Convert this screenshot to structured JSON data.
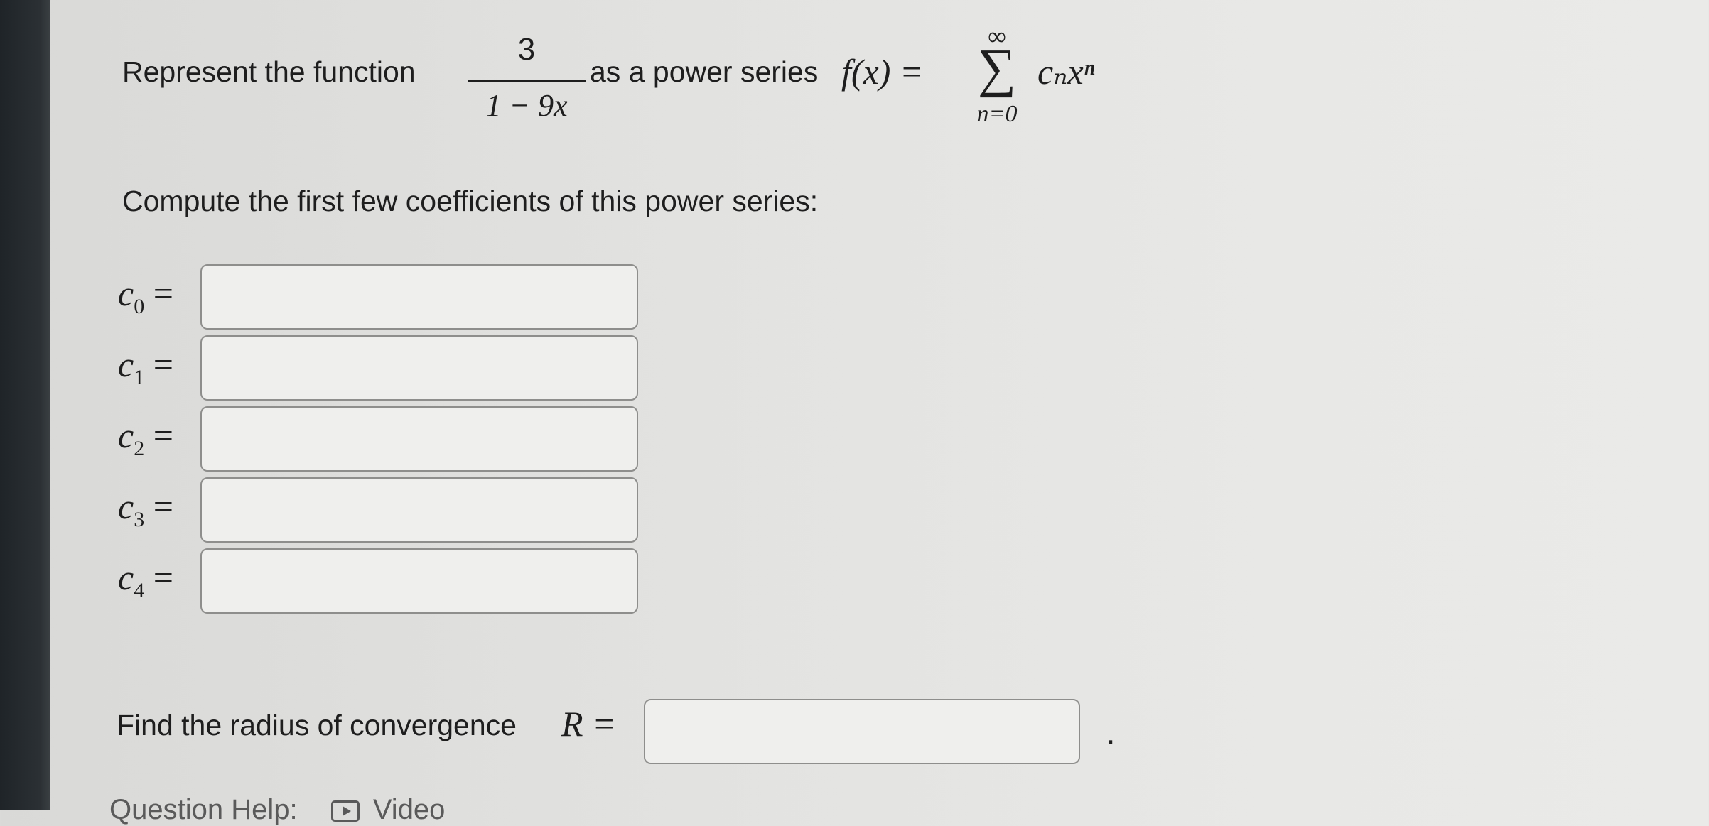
{
  "problem": {
    "intro_prefix": "Represent the function",
    "fraction": {
      "numerator": "3",
      "denominator": "1 − 9x"
    },
    "intro_mid": "as a power series",
    "series_lhs": "f(x) =",
    "sum_upper": "∞",
    "sum_symbol": "∑",
    "sum_lower": "n=0",
    "series_term": "cₙxⁿ"
  },
  "coefficients": {
    "prompt": "Compute the first few coefficients of this power series:",
    "rows": [
      {
        "symbol": "c",
        "index": "0",
        "equals": "=",
        "value": ""
      },
      {
        "symbol": "c",
        "index": "1",
        "equals": "=",
        "value": ""
      },
      {
        "symbol": "c",
        "index": "2",
        "equals": "=",
        "value": ""
      },
      {
        "symbol": "c",
        "index": "3",
        "equals": "=",
        "value": ""
      },
      {
        "symbol": "c",
        "index": "4",
        "equals": "=",
        "value": ""
      }
    ]
  },
  "radius": {
    "label": "Find the radius of convergence",
    "symbol": "R =",
    "value": "",
    "trailing": "."
  },
  "help": {
    "label": "Question Help:",
    "video_label": "Video",
    "icon": "video-play-icon"
  }
}
